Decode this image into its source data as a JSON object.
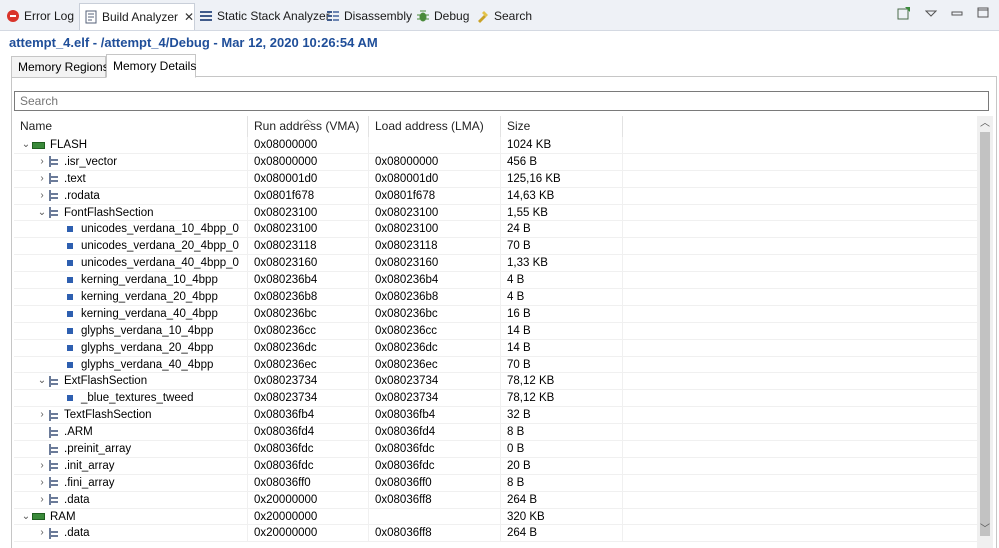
{
  "view_tabs": [
    {
      "label": "Error Log",
      "icon": "error-log-icon"
    },
    {
      "label": "Build Analyzer",
      "icon": "build-analyzer-icon"
    },
    {
      "label": "Static Stack Analyzer",
      "icon": "stack-analyzer-icon"
    },
    {
      "label": "Disassembly",
      "icon": "disassembly-icon"
    },
    {
      "label": "Debug",
      "icon": "debug-bug-icon"
    },
    {
      "label": "Search",
      "icon": "search-flashlight-icon"
    }
  ],
  "close_glyph": "✕",
  "toolbar_icons": [
    "open-console-icon",
    "view-menu-icon",
    "minimize-icon",
    "maximize-icon"
  ],
  "header": {
    "title": "attempt_4.elf - /attempt_4/Debug - Mar 12, 2020 10:26:54 AM"
  },
  "inner_tabs": [
    {
      "label": "Memory Regions"
    },
    {
      "label": "Memory Details"
    }
  ],
  "search": {
    "placeholder": "Search",
    "value": ""
  },
  "columns": [
    "Name",
    "Run address (VMA)",
    "Load address (LMA)",
    "Size"
  ],
  "rows": [
    {
      "indent": 0,
      "expander": "open",
      "icon": "chip",
      "name": "FLASH",
      "vma": "0x08000000",
      "lma": "",
      "size": "1024 KB"
    },
    {
      "indent": 1,
      "expander": "closed",
      "icon": "tree",
      "name": ".isr_vector",
      "vma": "0x08000000",
      "lma": "0x08000000",
      "size": "456 B"
    },
    {
      "indent": 1,
      "expander": "closed",
      "icon": "tree",
      "name": ".text",
      "vma": "0x080001d0",
      "lma": "0x080001d0",
      "size": "125,16 KB"
    },
    {
      "indent": 1,
      "expander": "closed",
      "icon": "tree",
      "name": ".rodata",
      "vma": "0x0801f678",
      "lma": "0x0801f678",
      "size": "14,63 KB"
    },
    {
      "indent": 1,
      "expander": "open",
      "icon": "tree",
      "name": "FontFlashSection",
      "vma": "0x08023100",
      "lma": "0x08023100",
      "size": "1,55 KB"
    },
    {
      "indent": 2,
      "expander": "none",
      "icon": "sym",
      "name": "unicodes_verdana_10_4bpp_0",
      "vma": "0x08023100",
      "lma": "0x08023100",
      "size": "24 B"
    },
    {
      "indent": 2,
      "expander": "none",
      "icon": "sym",
      "name": "unicodes_verdana_20_4bpp_0",
      "vma": "0x08023118",
      "lma": "0x08023118",
      "size": "70 B"
    },
    {
      "indent": 2,
      "expander": "none",
      "icon": "sym",
      "name": "unicodes_verdana_40_4bpp_0",
      "vma": "0x08023160",
      "lma": "0x08023160",
      "size": "1,33 KB"
    },
    {
      "indent": 2,
      "expander": "none",
      "icon": "sym",
      "name": "kerning_verdana_10_4bpp",
      "vma": "0x080236b4",
      "lma": "0x080236b4",
      "size": "4 B"
    },
    {
      "indent": 2,
      "expander": "none",
      "icon": "sym",
      "name": "kerning_verdana_20_4bpp",
      "vma": "0x080236b8",
      "lma": "0x080236b8",
      "size": "4 B"
    },
    {
      "indent": 2,
      "expander": "none",
      "icon": "sym",
      "name": "kerning_verdana_40_4bpp",
      "vma": "0x080236bc",
      "lma": "0x080236bc",
      "size": "16 B"
    },
    {
      "indent": 2,
      "expander": "none",
      "icon": "sym",
      "name": "glyphs_verdana_10_4bpp",
      "vma": "0x080236cc",
      "lma": "0x080236cc",
      "size": "14 B"
    },
    {
      "indent": 2,
      "expander": "none",
      "icon": "sym",
      "name": "glyphs_verdana_20_4bpp",
      "vma": "0x080236dc",
      "lma": "0x080236dc",
      "size": "14 B"
    },
    {
      "indent": 2,
      "expander": "none",
      "icon": "sym",
      "name": "glyphs_verdana_40_4bpp",
      "vma": "0x080236ec",
      "lma": "0x080236ec",
      "size": "70 B"
    },
    {
      "indent": 1,
      "expander": "open",
      "icon": "tree",
      "name": "ExtFlashSection",
      "vma": "0x08023734",
      "lma": "0x08023734",
      "size": "78,12 KB"
    },
    {
      "indent": 2,
      "expander": "none",
      "icon": "sym",
      "name": "_blue_textures_tweed",
      "vma": "0x08023734",
      "lma": "0x08023734",
      "size": "78,12 KB"
    },
    {
      "indent": 1,
      "expander": "closed",
      "icon": "tree",
      "name": "TextFlashSection",
      "vma": "0x08036fb4",
      "lma": "0x08036fb4",
      "size": "32 B"
    },
    {
      "indent": 1,
      "expander": "none",
      "icon": "tree",
      "name": ".ARM",
      "vma": "0x08036fd4",
      "lma": "0x08036fd4",
      "size": "8 B"
    },
    {
      "indent": 1,
      "expander": "none",
      "icon": "tree",
      "name": ".preinit_array",
      "vma": "0x08036fdc",
      "lma": "0x08036fdc",
      "size": "0 B"
    },
    {
      "indent": 1,
      "expander": "closed",
      "icon": "tree",
      "name": ".init_array",
      "vma": "0x08036fdc",
      "lma": "0x08036fdc",
      "size": "20 B"
    },
    {
      "indent": 1,
      "expander": "closed",
      "icon": "tree",
      "name": ".fini_array",
      "vma": "0x08036ff0",
      "lma": "0x08036ff0",
      "size": "8 B"
    },
    {
      "indent": 1,
      "expander": "closed",
      "icon": "tree",
      "name": ".data",
      "vma": "0x20000000",
      "lma": "0x08036ff8",
      "size": "264 B"
    },
    {
      "indent": 0,
      "expander": "open",
      "icon": "chip",
      "name": "RAM",
      "vma": "0x20000000",
      "lma": "",
      "size": "320 KB"
    },
    {
      "indent": 1,
      "expander": "closed",
      "icon": "tree",
      "name": ".data",
      "vma": "0x20000000",
      "lma": "0x08036ff8",
      "size": "264 B"
    }
  ],
  "colors": {
    "header_blue": "#1f4e99",
    "chip_green": "#3a8a3a",
    "symbol_blue": "#2e5fb0"
  }
}
